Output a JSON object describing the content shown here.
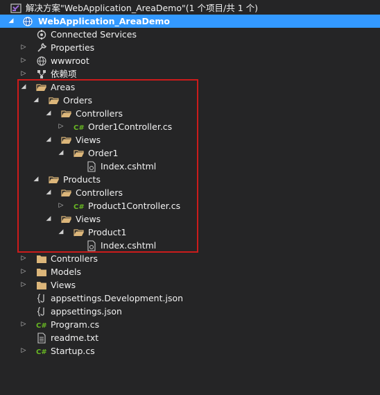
{
  "solution": {
    "label": "解决方案\"WebApplication_AreaDemo\"(1 个项目/共 1 个)"
  },
  "project": {
    "label": "WebApplication_AreaDemo"
  },
  "connected_services": {
    "label": "Connected Services"
  },
  "properties": {
    "label": "Properties"
  },
  "wwwroot": {
    "label": "wwwroot"
  },
  "dependencies": {
    "label": "依赖项"
  },
  "areas": {
    "label": "Areas",
    "orders": {
      "label": "Orders",
      "controllers_label": "Controllers",
      "controller_file": "Order1Controller.cs",
      "views_label": "Views",
      "subfolder": "Order1",
      "view_file": "Index.cshtml"
    },
    "products": {
      "label": "Products",
      "controllers_label": "Controllers",
      "controller_file": "Product1Controller.cs",
      "views_label": "Views",
      "subfolder": "Product1",
      "view_file": "Index.cshtml"
    }
  },
  "controllers": {
    "label": "Controllers"
  },
  "models": {
    "label": "Models"
  },
  "views": {
    "label": "Views"
  },
  "appsettings_dev": {
    "label": "appsettings.Development.json"
  },
  "appsettings": {
    "label": "appsettings.json"
  },
  "program": {
    "label": "Program.cs"
  },
  "readme": {
    "label": "readme.txt"
  },
  "startup": {
    "label": "Startup.cs"
  },
  "colors": {
    "background": "#252526",
    "selection": "#3399ff",
    "folder": "#dcb67a",
    "csharp": "#68b723",
    "highlight_border": "#cc1b1b"
  }
}
